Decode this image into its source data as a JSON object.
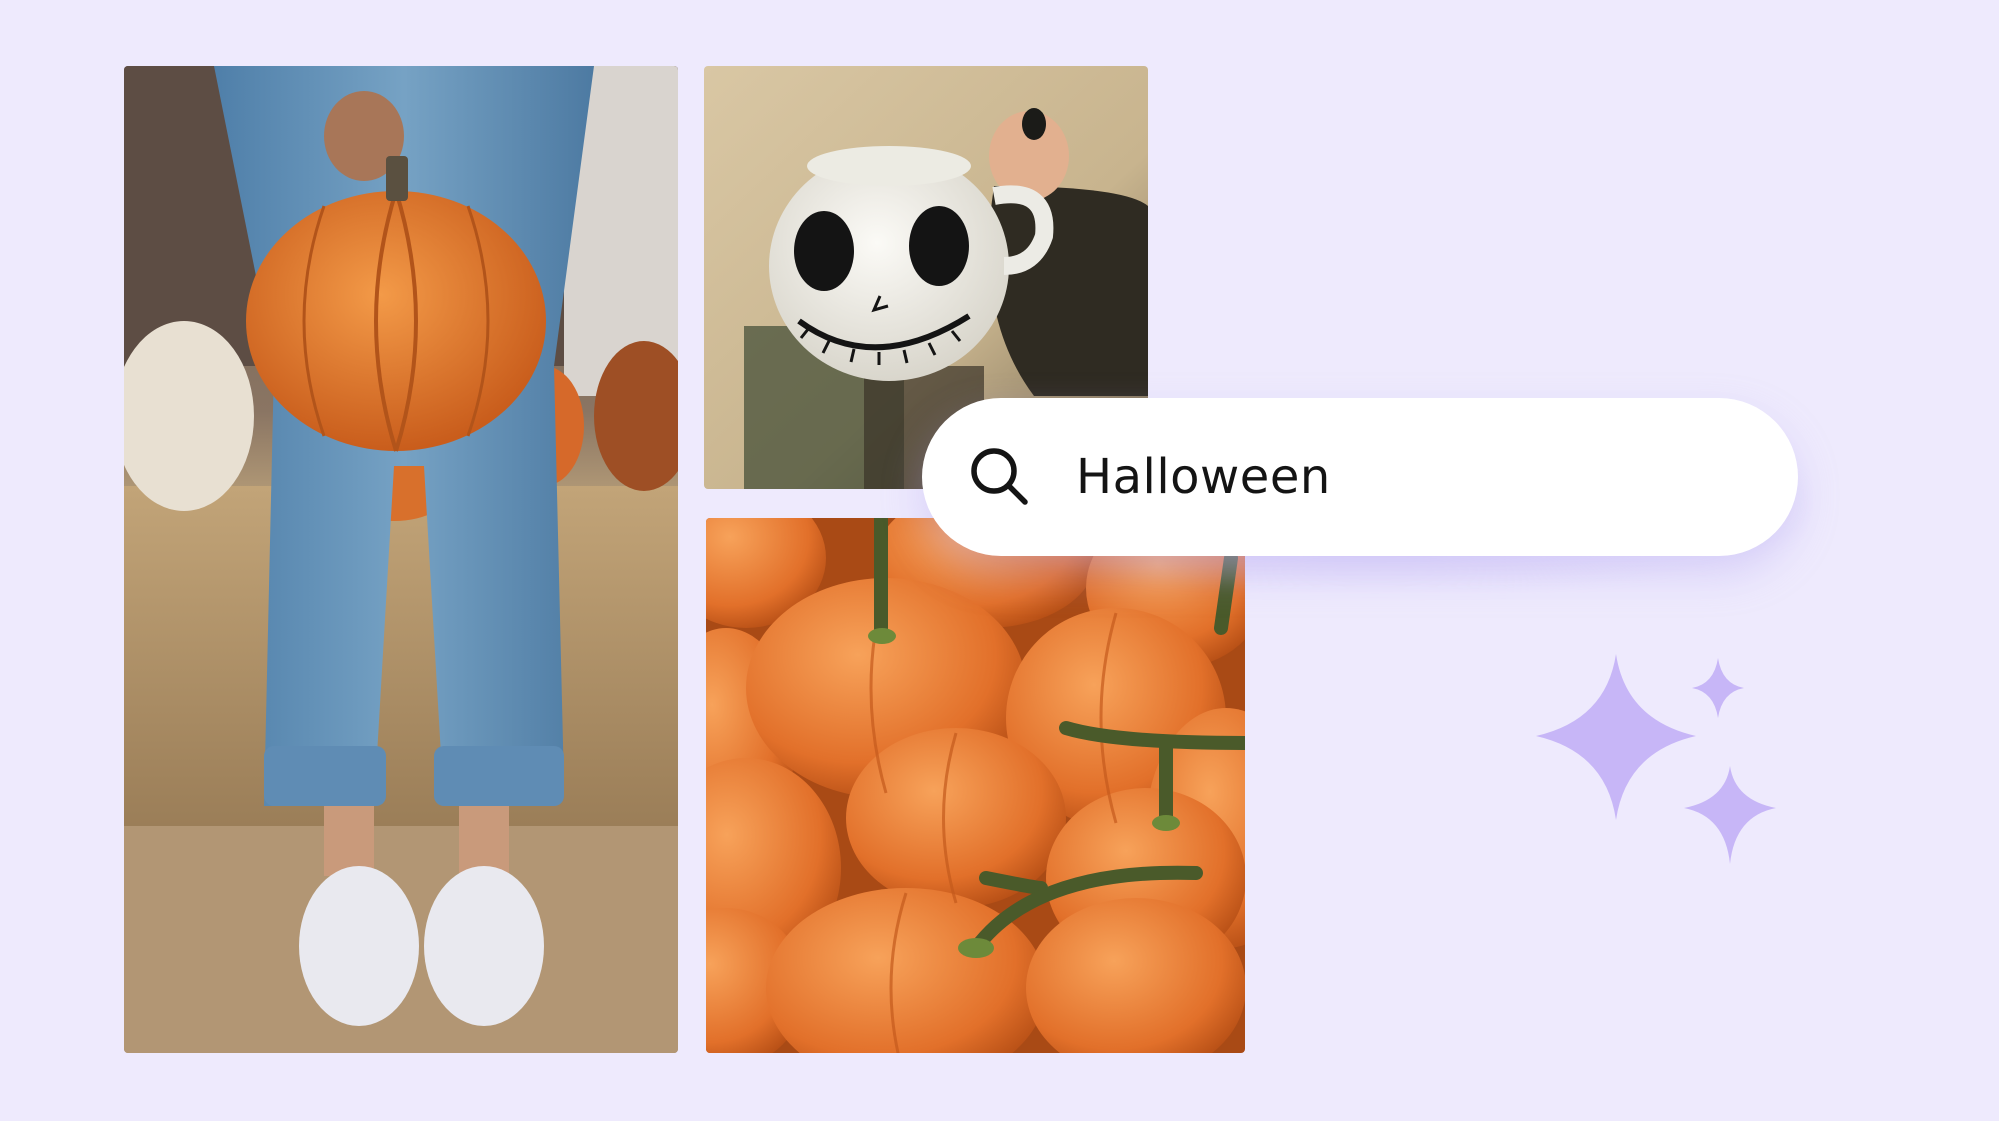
{
  "search": {
    "query": "Halloween",
    "icon": "search-icon"
  },
  "photos": [
    {
      "name": "photo-person-holding-pumpkin",
      "description_icon": "pumpkin"
    },
    {
      "name": "photo-skull-face-mug",
      "description_icon": "mug"
    },
    {
      "name": "photo-pile-of-pumpkins",
      "description_icon": "pumpkins"
    }
  ],
  "colors": {
    "background": "#EEEAFD",
    "search_bar": "#FFFFFF",
    "sparkle": "#C7B6F7",
    "pumpkin": "#E8772A"
  },
  "decorations": {
    "sparkles_icon": "sparkles-icon"
  }
}
